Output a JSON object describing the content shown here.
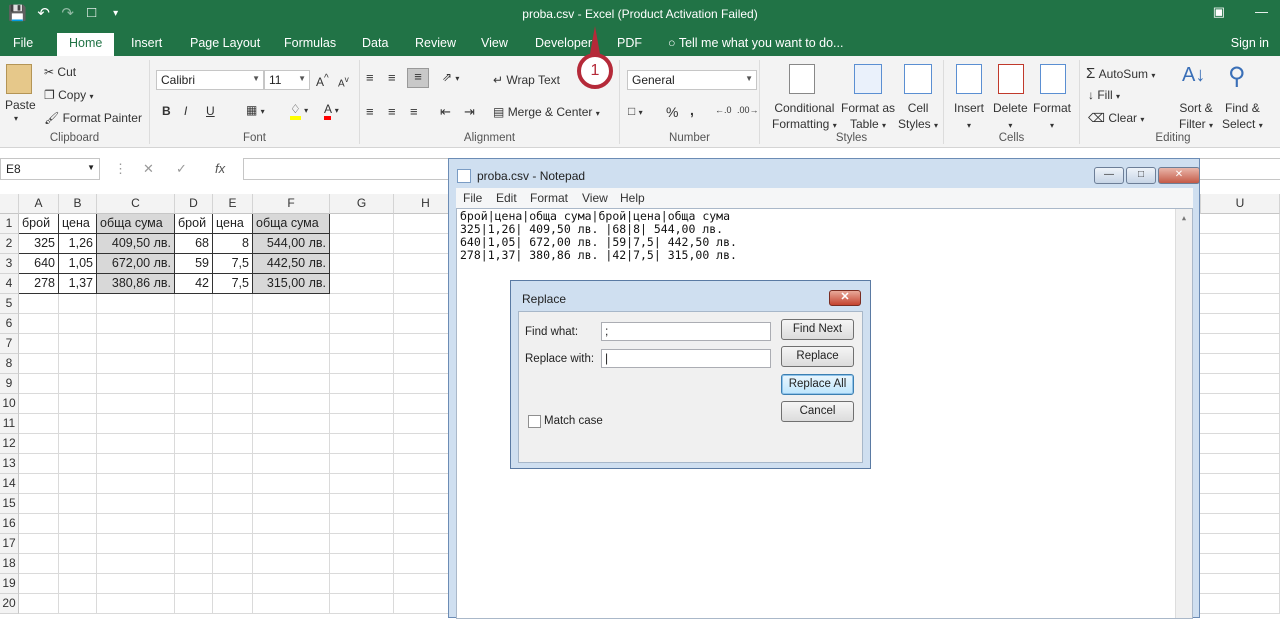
{
  "titlebar": {
    "title": "proba.csv - Excel (Product Activation Failed)"
  },
  "tabs": {
    "file": "File",
    "home": "Home",
    "insert": "Insert",
    "page_layout": "Page Layout",
    "formulas": "Formulas",
    "data": "Data",
    "review": "Review",
    "view": "View",
    "developer": "Developer",
    "pdf": "PDF",
    "tell_me": "Tell me what you want to do...",
    "sign_in": "Sign in"
  },
  "ribbon": {
    "clipboard": {
      "label": "Clipboard",
      "paste": "Paste",
      "cut": "Cut",
      "copy": "Copy",
      "format_painter": "Format Painter"
    },
    "font": {
      "label": "Font",
      "name": "Calibri",
      "size": "11",
      "bold": "B",
      "italic": "I",
      "underline": "U"
    },
    "alignment": {
      "label": "Alignment",
      "wrap_text": "Wrap Text",
      "merge_center": "Merge & Center"
    },
    "number": {
      "label": "Number",
      "format": "General",
      "percent": "%",
      "comma": ","
    },
    "styles": {
      "label": "Styles",
      "conditional_1": "Conditional",
      "conditional_2": "Formatting",
      "format_table_1": "Format as",
      "format_table_2": "Table",
      "cell_styles_1": "Cell",
      "cell_styles_2": "Styles"
    },
    "cells": {
      "label": "Cells",
      "insert": "Insert",
      "delete": "Delete",
      "format": "Format"
    },
    "editing": {
      "label": "Editing",
      "autosum": "AutoSum",
      "fill": "Fill",
      "clear": "Clear",
      "sort_1": "Sort &",
      "sort_2": "Filter",
      "find_1": "Find &",
      "find_2": "Select"
    }
  },
  "formula_bar": {
    "name_box": "E8",
    "fx": "fx",
    "value": ""
  },
  "annotation": {
    "number": "1"
  },
  "sheet": {
    "columns": [
      "A",
      "B",
      "C",
      "D",
      "E",
      "F",
      "G",
      "H",
      "U"
    ],
    "rows": [
      "1",
      "2",
      "3",
      "4",
      "5",
      "6",
      "7",
      "8",
      "9",
      "10",
      "11",
      "12",
      "13",
      "14",
      "15",
      "16",
      "17",
      "18",
      "19",
      "20"
    ],
    "data": [
      [
        "брой",
        "цена",
        "обща сума",
        "брой",
        "цена",
        "обща сума"
      ],
      [
        "325",
        "1,26",
        "409,50 лв.",
        "68",
        "8",
        "544,00 лв."
      ],
      [
        "640",
        "1,05",
        "672,00 лв.",
        "59",
        "7,5",
        "442,50 лв."
      ],
      [
        "278",
        "1,37",
        "380,86 лв.",
        "42",
        "7,5",
        "315,00 лв."
      ]
    ]
  },
  "notepad": {
    "title": "proba.csv - Notepad",
    "menu": [
      "File",
      "Edit",
      "Format",
      "View",
      "Help"
    ],
    "lines": [
      "брой|цена|обща сума|брой|цена|обща сума",
      "325|1,26| 409,50 лв. |68|8| 544,00 лв.",
      "640|1,05| 672,00 лв. |59|7,5| 442,50 лв.",
      "278|1,37| 380,86 лв. |42|7,5| 315,00 лв."
    ]
  },
  "replace_dialog": {
    "title": "Replace",
    "find_label": "Find what:",
    "find_value": ";",
    "replace_label": "Replace with:",
    "replace_value": "|",
    "find_next": "Find Next",
    "replace": "Replace",
    "replace_all": "Replace All",
    "cancel": "Cancel",
    "match_case": "Match case"
  }
}
